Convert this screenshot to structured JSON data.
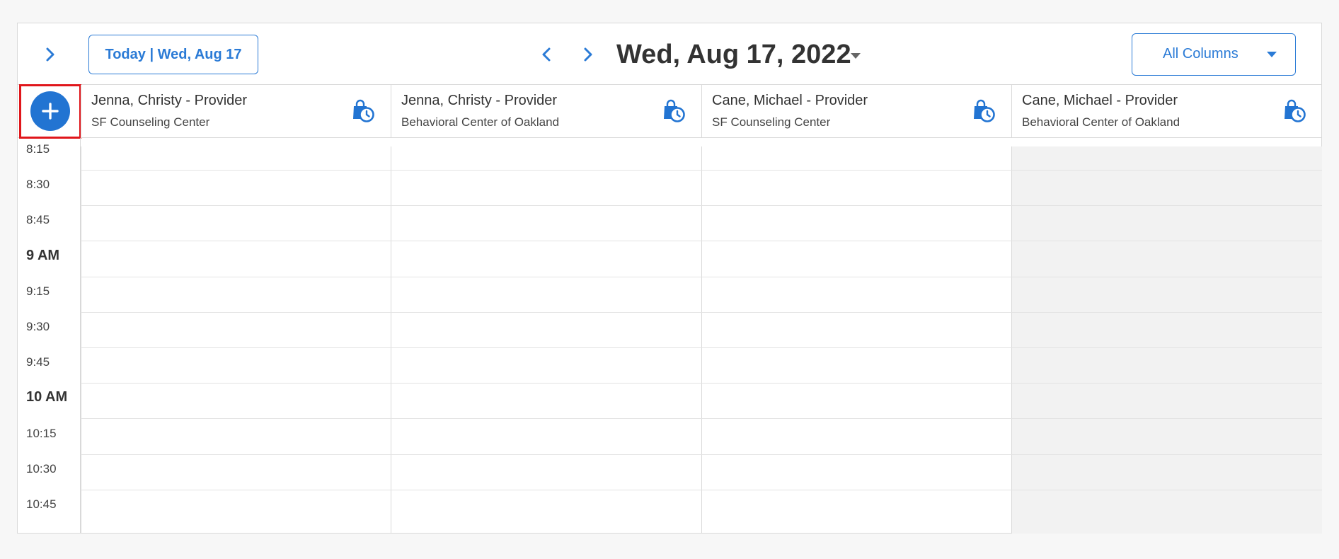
{
  "toolbar": {
    "collapse_icon": "chevron-right-icon",
    "today_label": "Today | Wed, Aug 17",
    "prev_icon": "chevron-left-icon",
    "next_icon": "chevron-right-icon",
    "date_title": "Wed, Aug 17, 2022",
    "date_caret_icon": "caret-down-icon",
    "columns_select": {
      "value": "All Columns",
      "caret_icon": "caret-down-icon"
    }
  },
  "add_button": {
    "icon": "plus-icon"
  },
  "columns": [
    {
      "name": "Jenna, Christy - Provider",
      "location": "SF Counseling Center",
      "icon": "availability-clock-icon",
      "available": true
    },
    {
      "name": "Jenna, Christy - Provider",
      "location": "Behavioral Center of Oakland",
      "icon": "availability-clock-icon",
      "available": true
    },
    {
      "name": "Cane, Michael - Provider",
      "location": "SF Counseling Center",
      "icon": "availability-clock-icon",
      "available": true
    },
    {
      "name": "Cane, Michael - Provider",
      "location": "Behavioral Center of Oakland",
      "icon": "availability-clock-icon",
      "available": false
    }
  ],
  "time_slots": [
    {
      "label": "8:15",
      "hour": false
    },
    {
      "label": "8:30",
      "hour": false
    },
    {
      "label": "8:45",
      "hour": false
    },
    {
      "label": "9 AM",
      "hour": true
    },
    {
      "label": "9:15",
      "hour": false
    },
    {
      "label": "9:30",
      "hour": false
    },
    {
      "label": "9:45",
      "hour": false
    },
    {
      "label": "10 AM",
      "hour": true
    },
    {
      "label": "10:15",
      "hour": false
    },
    {
      "label": "10:30",
      "hour": false
    },
    {
      "label": "10:45",
      "hour": false
    }
  ],
  "colors": {
    "accent": "#2b7bd6",
    "add_button": "#2274d2",
    "highlight_border": "#e0161b",
    "unavailable_bg": "#f2f2f2"
  }
}
